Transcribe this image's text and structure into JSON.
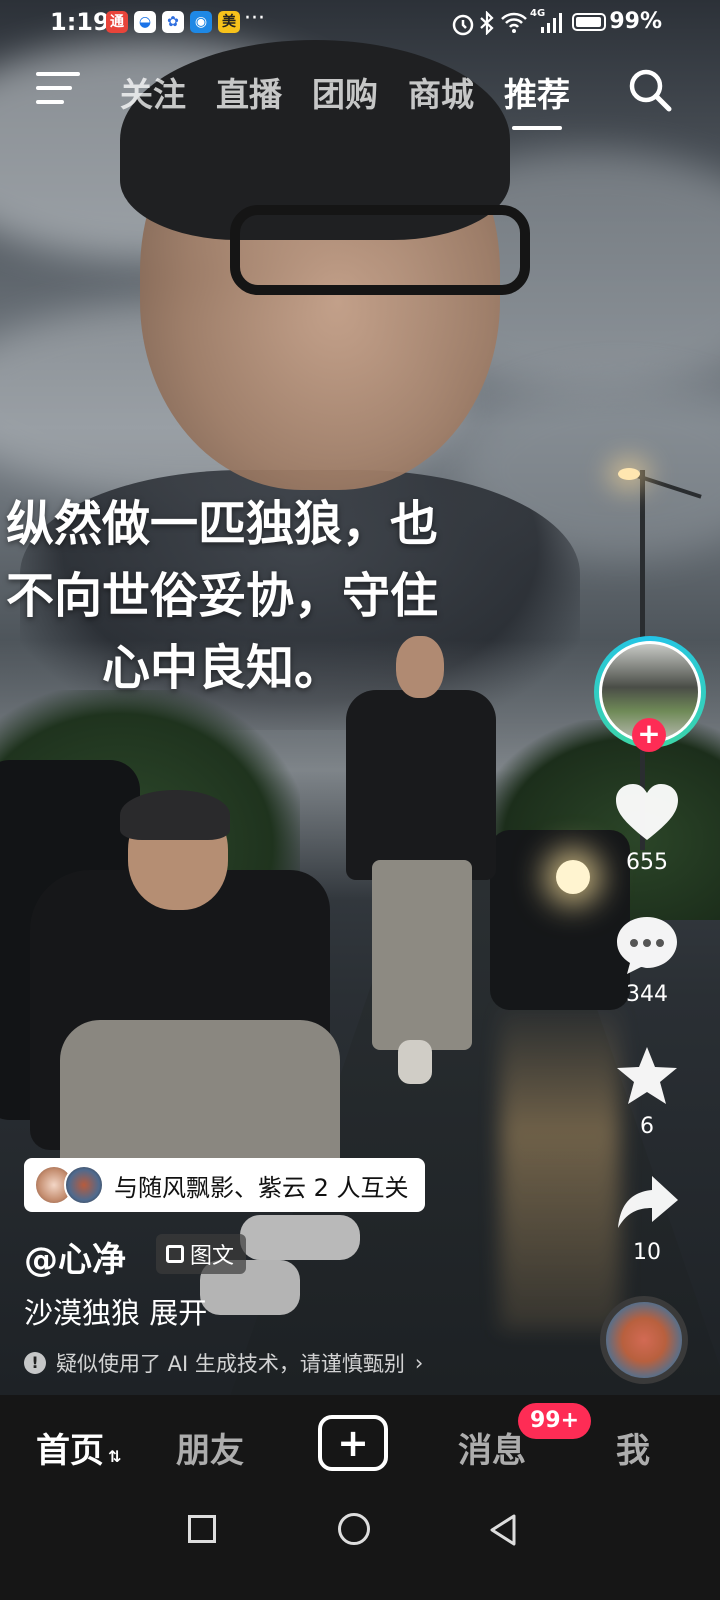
{
  "status_bar": {
    "time": "1:19",
    "app_icons": [
      {
        "name": "notification-app-icon-1",
        "glyph": "通",
        "color": "#e8443a"
      },
      {
        "name": "notification-app-icon-2",
        "glyph": "◒",
        "color": "#1a73e8"
      },
      {
        "name": "notification-app-icon-3",
        "glyph": "✿",
        "color": "#2f6fe0"
      },
      {
        "name": "notification-app-icon-4",
        "glyph": "◉",
        "color": "#1e88e5"
      },
      {
        "name": "notification-app-icon-5",
        "glyph": "美",
        "color": "#f7c21b"
      }
    ],
    "more": "···",
    "signal_label": "4G",
    "battery": "99%"
  },
  "top_nav": {
    "tabs": [
      "关注",
      "直播",
      "团购",
      "商城",
      "推荐"
    ],
    "active_tab": 4
  },
  "video": {
    "overlay_text": "纵然做一匹独狼，也\n不向世俗妥协，守住\n心中良知。"
  },
  "rail": {
    "like_count": "655",
    "comment_count": "344",
    "favorite_count": "6",
    "share_count": "10",
    "follow_symbol": "+"
  },
  "info": {
    "mutual_follow": "与随风飘影、紫云 2 人互关",
    "author": "@心净",
    "tag": "图文",
    "description": "沙漠独狼 展开",
    "ai_notice": "疑似使用了 AI 生成技术，请谨慎甄别",
    "ai_notice_arrow": "›"
  },
  "tab_bar": {
    "home": "首页",
    "friends": "朋友",
    "create": "+",
    "messages": "消息",
    "messages_badge": "99+",
    "me": "我"
  },
  "colors": {
    "accent": "#fe2c55",
    "ring": "#23c4e8",
    "tabbar_bg": "#161616"
  }
}
